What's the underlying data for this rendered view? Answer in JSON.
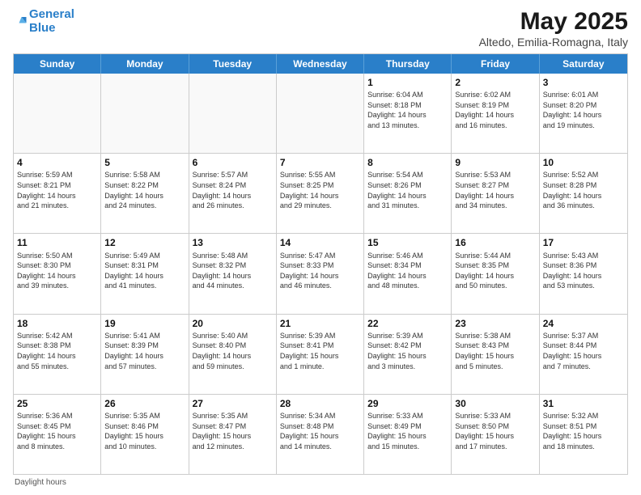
{
  "logo": {
    "line1": "General",
    "line2": "Blue"
  },
  "title": "May 2025",
  "subtitle": "Altedo, Emilia-Romagna, Italy",
  "weekdays": [
    "Sunday",
    "Monday",
    "Tuesday",
    "Wednesday",
    "Thursday",
    "Friday",
    "Saturday"
  ],
  "footer": "Daylight hours",
  "rows": [
    [
      {
        "day": "",
        "info": ""
      },
      {
        "day": "",
        "info": ""
      },
      {
        "day": "",
        "info": ""
      },
      {
        "day": "",
        "info": ""
      },
      {
        "day": "1",
        "info": "Sunrise: 6:04 AM\nSunset: 8:18 PM\nDaylight: 14 hours\nand 13 minutes."
      },
      {
        "day": "2",
        "info": "Sunrise: 6:02 AM\nSunset: 8:19 PM\nDaylight: 14 hours\nand 16 minutes."
      },
      {
        "day": "3",
        "info": "Sunrise: 6:01 AM\nSunset: 8:20 PM\nDaylight: 14 hours\nand 19 minutes."
      }
    ],
    [
      {
        "day": "4",
        "info": "Sunrise: 5:59 AM\nSunset: 8:21 PM\nDaylight: 14 hours\nand 21 minutes."
      },
      {
        "day": "5",
        "info": "Sunrise: 5:58 AM\nSunset: 8:22 PM\nDaylight: 14 hours\nand 24 minutes."
      },
      {
        "day": "6",
        "info": "Sunrise: 5:57 AM\nSunset: 8:24 PM\nDaylight: 14 hours\nand 26 minutes."
      },
      {
        "day": "7",
        "info": "Sunrise: 5:55 AM\nSunset: 8:25 PM\nDaylight: 14 hours\nand 29 minutes."
      },
      {
        "day": "8",
        "info": "Sunrise: 5:54 AM\nSunset: 8:26 PM\nDaylight: 14 hours\nand 31 minutes."
      },
      {
        "day": "9",
        "info": "Sunrise: 5:53 AM\nSunset: 8:27 PM\nDaylight: 14 hours\nand 34 minutes."
      },
      {
        "day": "10",
        "info": "Sunrise: 5:52 AM\nSunset: 8:28 PM\nDaylight: 14 hours\nand 36 minutes."
      }
    ],
    [
      {
        "day": "11",
        "info": "Sunrise: 5:50 AM\nSunset: 8:30 PM\nDaylight: 14 hours\nand 39 minutes."
      },
      {
        "day": "12",
        "info": "Sunrise: 5:49 AM\nSunset: 8:31 PM\nDaylight: 14 hours\nand 41 minutes."
      },
      {
        "day": "13",
        "info": "Sunrise: 5:48 AM\nSunset: 8:32 PM\nDaylight: 14 hours\nand 44 minutes."
      },
      {
        "day": "14",
        "info": "Sunrise: 5:47 AM\nSunset: 8:33 PM\nDaylight: 14 hours\nand 46 minutes."
      },
      {
        "day": "15",
        "info": "Sunrise: 5:46 AM\nSunset: 8:34 PM\nDaylight: 14 hours\nand 48 minutes."
      },
      {
        "day": "16",
        "info": "Sunrise: 5:44 AM\nSunset: 8:35 PM\nDaylight: 14 hours\nand 50 minutes."
      },
      {
        "day": "17",
        "info": "Sunrise: 5:43 AM\nSunset: 8:36 PM\nDaylight: 14 hours\nand 53 minutes."
      }
    ],
    [
      {
        "day": "18",
        "info": "Sunrise: 5:42 AM\nSunset: 8:38 PM\nDaylight: 14 hours\nand 55 minutes."
      },
      {
        "day": "19",
        "info": "Sunrise: 5:41 AM\nSunset: 8:39 PM\nDaylight: 14 hours\nand 57 minutes."
      },
      {
        "day": "20",
        "info": "Sunrise: 5:40 AM\nSunset: 8:40 PM\nDaylight: 14 hours\nand 59 minutes."
      },
      {
        "day": "21",
        "info": "Sunrise: 5:39 AM\nSunset: 8:41 PM\nDaylight: 15 hours\nand 1 minute."
      },
      {
        "day": "22",
        "info": "Sunrise: 5:39 AM\nSunset: 8:42 PM\nDaylight: 15 hours\nand 3 minutes."
      },
      {
        "day": "23",
        "info": "Sunrise: 5:38 AM\nSunset: 8:43 PM\nDaylight: 15 hours\nand 5 minutes."
      },
      {
        "day": "24",
        "info": "Sunrise: 5:37 AM\nSunset: 8:44 PM\nDaylight: 15 hours\nand 7 minutes."
      }
    ],
    [
      {
        "day": "25",
        "info": "Sunrise: 5:36 AM\nSunset: 8:45 PM\nDaylight: 15 hours\nand 8 minutes."
      },
      {
        "day": "26",
        "info": "Sunrise: 5:35 AM\nSunset: 8:46 PM\nDaylight: 15 hours\nand 10 minutes."
      },
      {
        "day": "27",
        "info": "Sunrise: 5:35 AM\nSunset: 8:47 PM\nDaylight: 15 hours\nand 12 minutes."
      },
      {
        "day": "28",
        "info": "Sunrise: 5:34 AM\nSunset: 8:48 PM\nDaylight: 15 hours\nand 14 minutes."
      },
      {
        "day": "29",
        "info": "Sunrise: 5:33 AM\nSunset: 8:49 PM\nDaylight: 15 hours\nand 15 minutes."
      },
      {
        "day": "30",
        "info": "Sunrise: 5:33 AM\nSunset: 8:50 PM\nDaylight: 15 hours\nand 17 minutes."
      },
      {
        "day": "31",
        "info": "Sunrise: 5:32 AM\nSunset: 8:51 PM\nDaylight: 15 hours\nand 18 minutes."
      }
    ]
  ]
}
